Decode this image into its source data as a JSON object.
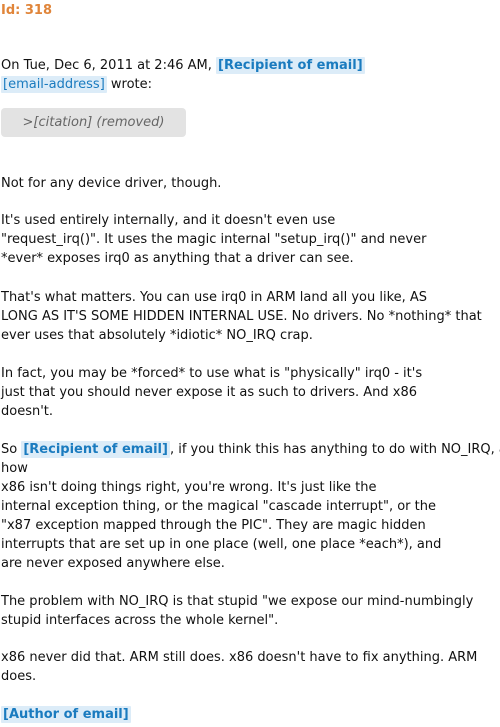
{
  "header": {
    "id_label": "Id: 318"
  },
  "quote_intro": {
    "date_text": "On Tue, Dec 6, 2011 at 2:46 AM,",
    "recipient_tag": "[Recipient of email]",
    "email_tag": "[email-address]",
    "wrote_text": " wrote:"
  },
  "citation": {
    "label": ">[citation] (removed)"
  },
  "body": {
    "p1": [
      "Not for any device driver, though."
    ],
    "p2": [
      "It's used entirely internally, and it doesn't even use",
      "\"request_irq()\". It uses the magic internal \"setup_irq()\" and never",
      "*ever* exposes irq0 as anything that a driver can see."
    ],
    "p3": [
      "That's what matters. You can use irq0 in ARM land all you like, AS",
      "LONG AS IT'S SOME HIDDEN INTERNAL USE. No drivers. No *nothing* that",
      "ever uses that absolutely *idiotic* NO_IRQ crap."
    ],
    "p4": [
      "In fact, you may be *forced* to use what is \"physically\" irq0 - it's",
      "just that you should never expose it as such to drivers. And x86",
      "doesn't."
    ],
    "p5_prefix": "So ",
    "p5_tag": "[Recipient of email]",
    "p5_first_suffix": ", if you think this has anything to do with NO_IRQ, and",
    "p5_rest": [
      "how",
      "x86 isn't doing things right, you're wrong. It's just like the",
      "internal exception thing, or the magical \"cascade interrupt\", or the",
      "\"x87 exception mapped through the PIC\". They are magic hidden",
      "interrupts that are set up in one place (well, one place *each*), and",
      "are never exposed anywhere else."
    ],
    "p6": [
      "The problem with NO_IRQ is that stupid \"we expose our mind-numbingly",
      "stupid interfaces across the whole kernel\"."
    ],
    "p7": [
      "x86 never did that. ARM still does. x86 doesn't have to fix anything. ARM",
      "does."
    ]
  },
  "signature": {
    "author_tag": "[Author of email]"
  },
  "colors": {
    "id_color": "#e0853a",
    "tag_bg": "#dcecf8",
    "tag_text": "#1a7bbf",
    "citation_bg": "#e3e3e3"
  }
}
